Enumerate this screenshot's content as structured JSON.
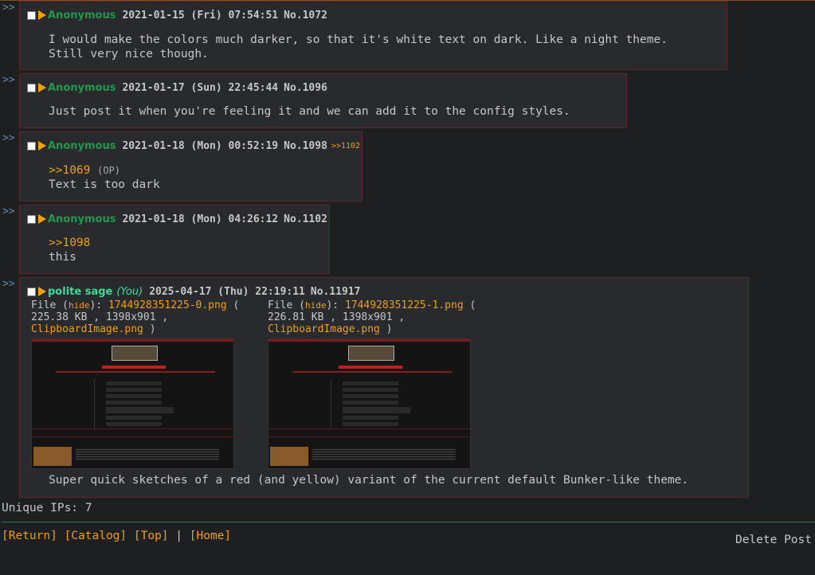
{
  "marker": ">>",
  "posts": [
    {
      "name": "Anonymous",
      "date": "2021-01-15 (Fri) 07:54:51",
      "number": "No.1072",
      "lines": [
        "I would make the colors much darker, so that it's white text on dark. Like a night theme.",
        "Still very nice though."
      ]
    },
    {
      "name": "Anonymous",
      "date": "2021-01-17 (Sun) 22:45:44",
      "number": "No.1096",
      "lines": [
        "Just post it when you're feeling it and we can add it to the config styles."
      ]
    },
    {
      "name": "Anonymous",
      "date": "2021-01-18 (Mon) 00:52:19",
      "number": "No.1098",
      "reply": ">>1102",
      "quote": ">>1069",
      "quote_note": "(OP)",
      "lines": [
        "Text is too dark"
      ]
    },
    {
      "name": "Anonymous",
      "date": "2021-01-18 (Mon) 04:26:12",
      "number": "No.1102",
      "quote": ">>1098",
      "lines": [
        "this"
      ]
    },
    {
      "name": "polite sage",
      "you": "(You)",
      "date": "2025-04-17 (Thu) 22:19:11",
      "number": "No.11917",
      "files": [
        {
          "prefix": "File (",
          "hide": "hide",
          "mid": "): ",
          "filename": "1744928351225-0.png",
          "open": " (",
          "info": "225.38 KB , 1398x901 ,",
          "orig": "ClipboardImage.png",
          "close": " )"
        },
        {
          "prefix": "File (",
          "hide": "hide",
          "mid": "): ",
          "filename": "1744928351225-1.png",
          "open": " (",
          "info": "226.81 KB , 1398x901 ,",
          "orig": "ClipboardImage.png",
          "close": " )"
        }
      ],
      "lines": [
        "Super quick sketches of a red (and yellow) variant of the current default Bunker-like theme."
      ]
    }
  ],
  "footer": {
    "unique_ips": "Unique IPs: 7",
    "nav": [
      "[Return]",
      "[Catalog]",
      "[Top]",
      "[Home]"
    ],
    "separator": "|",
    "delete_post": "Delete Post"
  },
  "colors": {
    "accent": "#f0a000",
    "name": "#1f9a4d",
    "you": "#3ddc97",
    "border": "#5a2a2a",
    "background": "#1d1f21"
  }
}
